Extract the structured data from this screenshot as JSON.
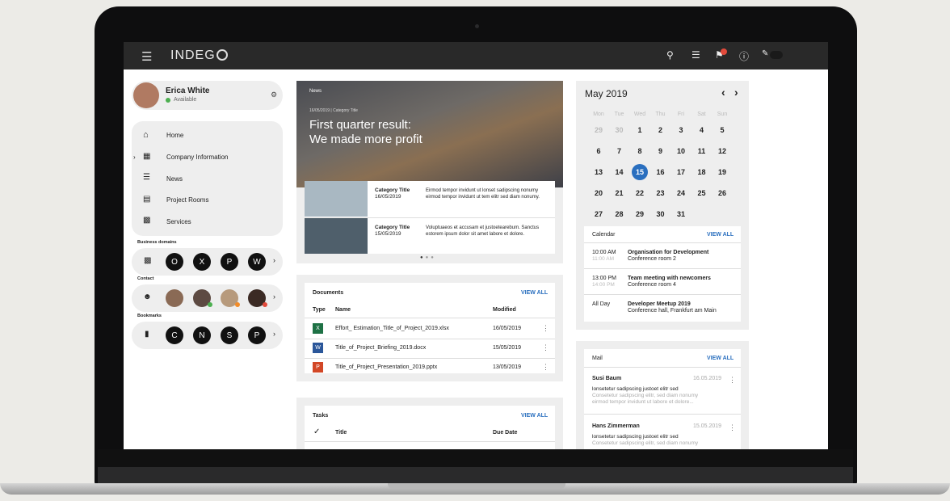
{
  "app": {
    "logo": "INDEG"
  },
  "topbar": {
    "icons": [
      "menu-icon",
      "search-icon",
      "filter-icon",
      "bell-icon",
      "help-icon",
      "edit-icon"
    ]
  },
  "user": {
    "name": "Erica White",
    "status": "Available"
  },
  "nav": [
    {
      "label": "Home",
      "icon": "home-icon"
    },
    {
      "label": "Company Information",
      "icon": "building-icon"
    },
    {
      "label": "News",
      "icon": "news-icon"
    },
    {
      "label": "Project Rooms",
      "icon": "list-icon"
    },
    {
      "label": "Services",
      "icon": "grid-icon"
    }
  ],
  "business": {
    "title": "Business domains",
    "apps": [
      "O",
      "X",
      "P",
      "W"
    ]
  },
  "contact": {
    "title": "Contact"
  },
  "bookmarks": {
    "title": "Bookmarks",
    "items": [
      "C",
      "N",
      "S",
      "P"
    ]
  },
  "news": {
    "tag": "News",
    "meta": "16/05/2019 | Category Title",
    "headline1": "First quarter result:",
    "headline2": "We made more profit",
    "items": [
      {
        "cat": "Category Title",
        "date": "16/05/2019",
        "text": "Eirmod tempor invidunt ut lonset sadipscing nonumy eirmod tempor invidunt ut tem elitr sed diam nonumy."
      },
      {
        "cat": "Category Title",
        "date": "15/05/2019",
        "text": "Voluptuaeos et accusam et justoetearebum. Sanctus estorem ipsum dolor sit amet labore et dolore."
      }
    ]
  },
  "documents": {
    "title": "Documents",
    "viewall": "VIEW ALL",
    "col_type": "Type",
    "col_name": "Name",
    "col_modified": "Modified",
    "rows": [
      {
        "icon": "X",
        "name": "Effort_ Estimation_Title_of_Project_2019.xlsx",
        "date": "16/05/2019",
        "color": "#1e7145"
      },
      {
        "icon": "W",
        "name": "Title_of_Project_Briefing_2019.docx",
        "date": "15/05/2019",
        "color": "#2b579a"
      },
      {
        "icon": "P",
        "name": "Title_of_Project_Presentation_2019.pptx",
        "date": "13/05/2019",
        "color": "#d24726"
      }
    ]
  },
  "tasks": {
    "title": "Tasks",
    "viewall": "VIEW ALL",
    "col_title": "Title",
    "col_due": "Due Date"
  },
  "calendar": {
    "month": "May 2019",
    "days": [
      "Mon",
      "Tue",
      "Wed",
      "Thu",
      "Fri",
      "Sat",
      "Sun"
    ],
    "weeks": [
      [
        "29",
        "30",
        "1",
        "2",
        "3",
        "4",
        "5"
      ],
      [
        "6",
        "7",
        "8",
        "9",
        "10",
        "11",
        "12"
      ],
      [
        "13",
        "14",
        "15",
        "16",
        "17",
        "18",
        "19"
      ],
      [
        "20",
        "21",
        "22",
        "23",
        "24",
        "25",
        "26"
      ],
      [
        "27",
        "28",
        "29",
        "30",
        "31",
        "",
        ""
      ]
    ],
    "today": "15"
  },
  "events": {
    "title": "Calendar",
    "viewall": "VIEW ALL",
    "items": [
      {
        "start": "10:00 AM",
        "end": "11:00 AM",
        "title": "Organisation for Development",
        "place": "Conference room 2"
      },
      {
        "start": "13:00 PM",
        "end": "14:00 PM",
        "title": "Team meeting with newcomers",
        "place": "Conference room 4"
      },
      {
        "start": "All Day",
        "end": "",
        "title": "Developer Meetup 2019",
        "place": "Conference hall, Frankfurt am Main"
      }
    ]
  },
  "mail": {
    "title": "Mail",
    "viewall": "VIEW ALL",
    "items": [
      {
        "from": "Susi Baum",
        "date": "16.05.2019",
        "line1": "lonsetetur sadipscing justoet elitr sed",
        "line2": "Consetetur sadipscing elitr, sed diam nonumy",
        "line3": "eirmod tempor invidunt ut labore et dolore..."
      },
      {
        "from": "Hans Zimmerman",
        "date": "15.05.2019",
        "line1": "lonsetetur sadipscing justoet elitr sed",
        "line2": "Consetetur sadipscing elitr, sed diam nonumy",
        "line3": ""
      }
    ]
  }
}
